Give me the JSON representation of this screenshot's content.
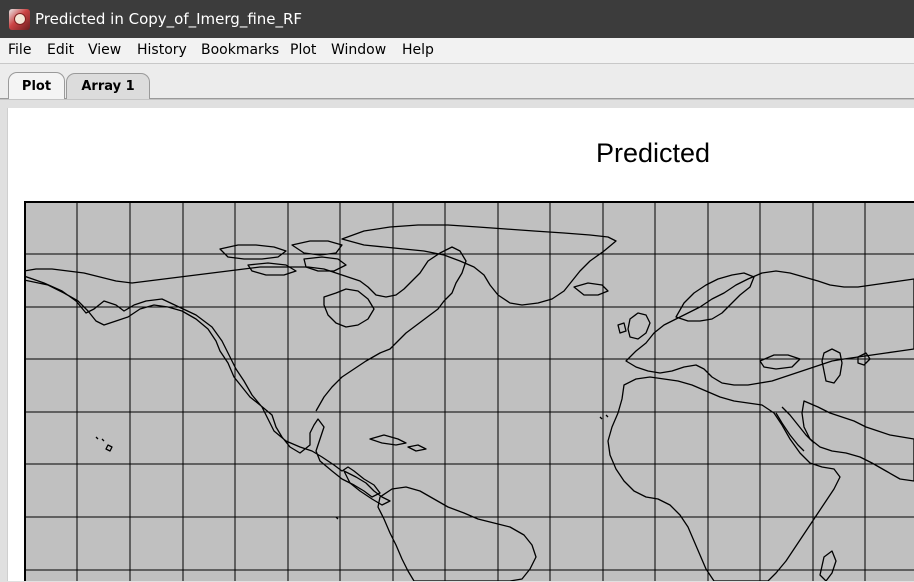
{
  "window": {
    "title": "Predicted in Copy_of_Imerg_fine_RF",
    "icon": "app-logo-icon"
  },
  "menu": {
    "items": [
      "File",
      "Edit",
      "View",
      "History",
      "Bookmarks",
      "Plot",
      "Window",
      "Help"
    ]
  },
  "tabs": [
    {
      "label": "Plot",
      "selected": true
    },
    {
      "label": "Array 1",
      "selected": false
    }
  ],
  "plot": {
    "title": "Predicted",
    "map_type": "world coastline map with lat/lon grid",
    "colors": {
      "land_and_ocean_fill": "#c0c0c0",
      "grid_lines": "#000000",
      "coastlines": "#000000",
      "panel_background": "#ffffff"
    }
  }
}
